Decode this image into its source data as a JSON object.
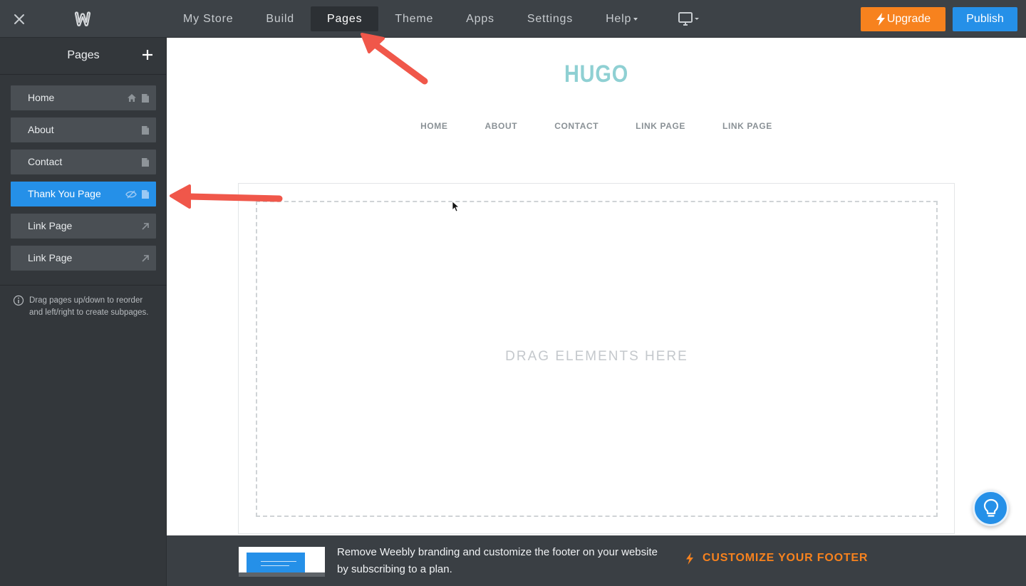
{
  "topbar": {
    "nav": [
      "My Store",
      "Build",
      "Pages",
      "Theme",
      "Apps",
      "Settings",
      "Help"
    ],
    "active_tab": "Pages",
    "upgrade_label": "Upgrade",
    "publish_label": "Publish"
  },
  "sidebar": {
    "title": "Pages",
    "pages": [
      {
        "label": "Home",
        "icons": [
          "home-icon",
          "page-icon"
        ],
        "active": false
      },
      {
        "label": "About",
        "icons": [
          "page-icon"
        ],
        "active": false
      },
      {
        "label": "Contact",
        "icons": [
          "page-icon"
        ],
        "active": false
      },
      {
        "label": "Thank You Page",
        "icons": [
          "hidden-eye-icon",
          "page-icon"
        ],
        "active": true
      },
      {
        "label": "Link Page",
        "icons": [
          "external-link-icon"
        ],
        "active": false
      },
      {
        "label": "Link Page",
        "icons": [
          "external-link-icon"
        ],
        "active": false
      }
    ],
    "hint": "Drag pages up/down to reorder and left/right to create subpages."
  },
  "canvas": {
    "site_title": "HUGO",
    "site_nav": [
      "HOME",
      "ABOUT",
      "CONTACT",
      "LINK PAGE",
      "LINK PAGE"
    ],
    "drop_text": "DRAG ELEMENTS HERE"
  },
  "footer": {
    "text": "Remove Weebly branding and customize the footer on your website by subscribing to a plan.",
    "cta": "CUSTOMIZE YOUR FOOTER"
  },
  "colors": {
    "accent_blue": "#2590e8",
    "upgrade_orange": "#f7821e",
    "site_title_teal": "#8fd0d3",
    "annotation_arrow": "#f0574a"
  }
}
